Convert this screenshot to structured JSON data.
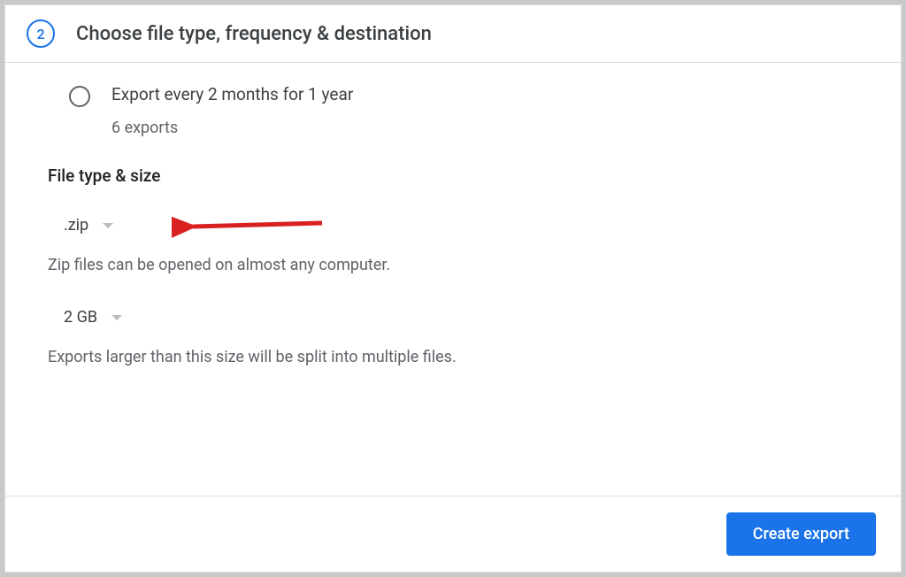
{
  "step": {
    "number": "2",
    "title": "Choose file type, frequency & destination"
  },
  "frequency": {
    "option_label": "Export every 2 months for 1 year",
    "option_sublabel": "6 exports"
  },
  "file_section": {
    "title": "File type & size",
    "type_selected": ".zip",
    "type_help": "Zip files can be opened on almost any computer.",
    "size_selected": "2 GB",
    "size_help": "Exports larger than this size will be split into multiple files."
  },
  "footer": {
    "create_label": "Create export"
  }
}
